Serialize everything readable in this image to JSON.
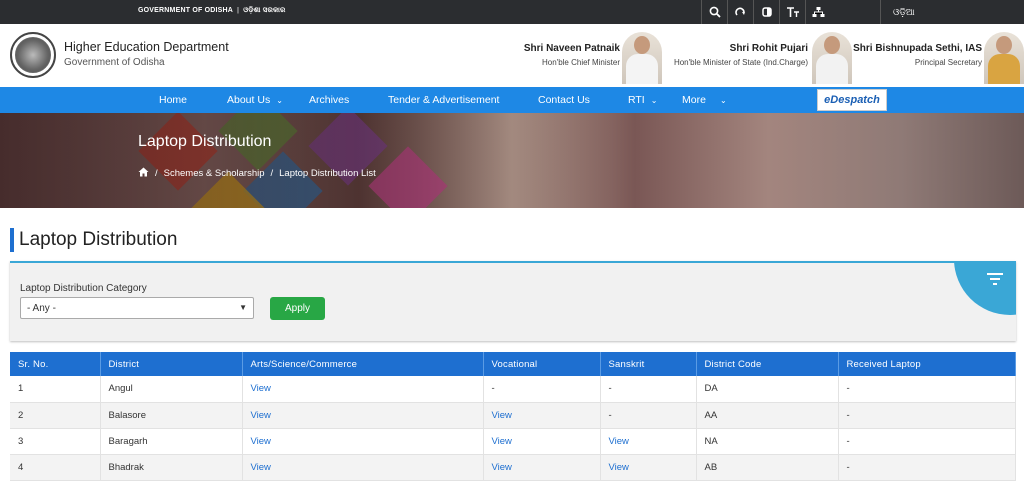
{
  "topbar": {
    "gov_text": "GOVERNMENT OF ODISHA",
    "gov_odia": "ଓଡ଼ିଶା ସରକାର",
    "tools": [
      "search-icon",
      "redo-icon",
      "contrast-icon",
      "text-size-icon",
      "sitemap-icon"
    ],
    "language": "ଓଡ଼ିଆ"
  },
  "header": {
    "dept_title": "Higher Education Department",
    "dept_subtitle": "Government of Odisha",
    "people": [
      {
        "name": "Shri Naveen Patnaik",
        "role": "Hon'ble Chief Minister"
      },
      {
        "name": "Shri Rohit Pujari",
        "role": "Hon'ble Minister of State (Ind.Charge)"
      },
      {
        "name": "Shri Bishnupada Sethi, IAS",
        "role": "Principal Secretary"
      }
    ]
  },
  "nav": {
    "items": [
      "Home",
      "About Us",
      "Archives",
      "Tender & Advertisement",
      "Contact Us",
      "RTI",
      "More"
    ],
    "despatch": "eDespatch"
  },
  "banner": {
    "title": "Laptop Distribution",
    "crumbs": [
      "Schemes & Scholarship",
      "Laptop Distribution List"
    ]
  },
  "page": {
    "title": "Laptop Distribution",
    "filter_label": "Laptop Distribution Category",
    "select_value": "- Any -",
    "apply_label": "Apply"
  },
  "table": {
    "headers": [
      "Sr. No.",
      "District",
      "Arts/Science/Commerce",
      "Vocational",
      "Sanskrit",
      "District Code",
      "Received Laptop"
    ],
    "rows": [
      [
        "1",
        "Angul",
        "View",
        "-",
        "-",
        "DA",
        "-"
      ],
      [
        "2",
        "Balasore",
        "View",
        "View",
        "-",
        "AA",
        "-"
      ],
      [
        "3",
        "Baragarh",
        "View",
        "View",
        "View",
        "NA",
        "-"
      ],
      [
        "4",
        "Bhadrak",
        "View",
        "View",
        "View",
        "AB",
        "-"
      ]
    ]
  },
  "colors": {
    "nav": "#1e88e5",
    "table_header": "#1e6fd0",
    "apply": "#28a745",
    "accent": "#3aa7d6"
  }
}
